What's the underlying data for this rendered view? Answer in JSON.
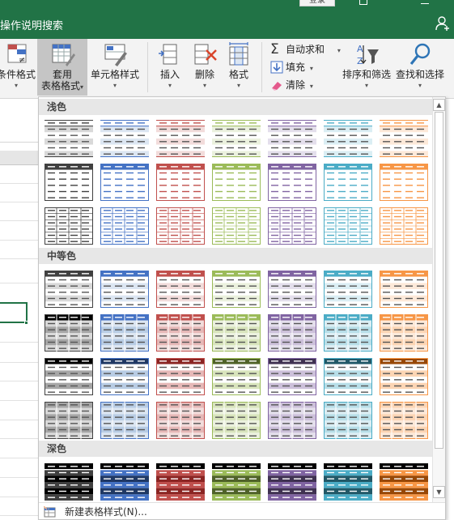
{
  "titlebar": {
    "login_label": "登录"
  },
  "tellme": {
    "text": "操作说明搜索"
  },
  "ribbon": {
    "conditional_format": {
      "line1": "条件格式",
      "arrow": "▾"
    },
    "format_as_table": {
      "line1": "套用",
      "line2": "表格格式",
      "arrow": "▾"
    },
    "cell_styles": {
      "line1": "单元格样式",
      "arrow": "▾"
    },
    "insert": {
      "line1": "插入",
      "arrow": "▾"
    },
    "delete": {
      "line1": "删除",
      "arrow": "▾"
    },
    "format": {
      "line1": "格式",
      "arrow": "▾"
    },
    "autosum": {
      "label": "自动求和",
      "arrow": "▾"
    },
    "fill": {
      "label": "填充",
      "arrow": "▾"
    },
    "clear": {
      "label": "清除",
      "arrow": "▾"
    },
    "sort_filter": {
      "line1": "排序和筛选",
      "arrow": "▾"
    },
    "find_select": {
      "line1": "查找和选择",
      "arrow": "▾"
    }
  },
  "gallery": {
    "sections": {
      "light": "浅色",
      "medium": "中等色",
      "dark": "深色"
    },
    "new_style_label": "新建表格样式(N)...",
    "scroll_up": "▲",
    "scroll_down": "▼",
    "palette": [
      "#404040",
      "#4472c4",
      "#c0504d",
      "#9bbb59",
      "#8064a2",
      "#4bacc6",
      "#f79646"
    ],
    "light_palette": [
      "#d9d9d9",
      "#dce6f2",
      "#f2dcdb",
      "#ebf1de",
      "#e4dfec",
      "#dbeef4",
      "#fde9d9"
    ],
    "mid_palette": [
      "#a6a6a6",
      "#b8cce4",
      "#e6b8b7",
      "#d8e4bc",
      "#ccc0da",
      "#b7dee8",
      "#fcd5b4"
    ],
    "dark_palette": [
      "#000000",
      "#1f3864",
      "#8b2523",
      "#4f6228",
      "#3f3151",
      "#215867",
      "#974706"
    ]
  }
}
